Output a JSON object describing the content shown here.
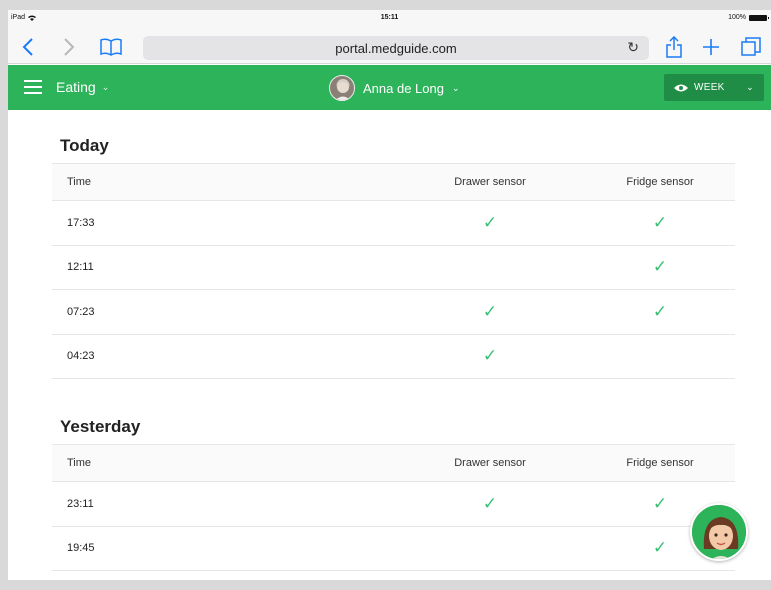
{
  "status_bar": {
    "device": "iPad",
    "time": "15:11",
    "battery": "100%"
  },
  "browser": {
    "url": "portal.medguide.com"
  },
  "app_bar": {
    "section": "Eating",
    "user_name": "Anna de Long",
    "period": "WEEK",
    "accent": "#2db45b"
  },
  "columns": {
    "time": "Time",
    "drawer": "Drawer sensor",
    "fridge": "Fridge sensor"
  },
  "sections": [
    {
      "title": "Today",
      "rows": [
        {
          "time": "17:33",
          "drawer": true,
          "fridge": true
        },
        {
          "time": "12:11",
          "drawer": false,
          "fridge": true
        },
        {
          "time": "07:23",
          "drawer": true,
          "fridge": true
        },
        {
          "time": "04:23",
          "drawer": true,
          "fridge": false
        }
      ]
    },
    {
      "title": "Yesterday",
      "rows": [
        {
          "time": "23:11",
          "drawer": true,
          "fridge": true
        },
        {
          "time": "19:45",
          "drawer": false,
          "fridge": true
        }
      ]
    }
  ],
  "check_glyph": "✓"
}
